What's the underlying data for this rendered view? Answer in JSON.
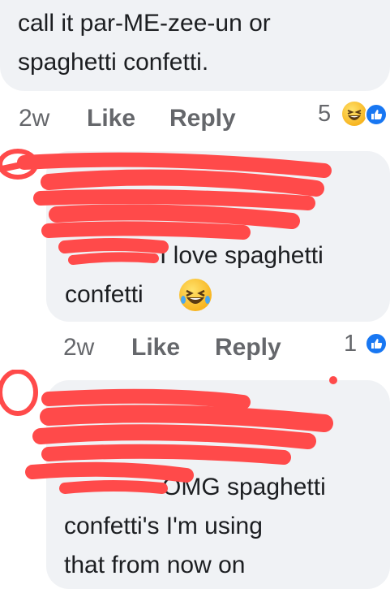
{
  "comments": [
    {
      "text_lines": [
        "call it par-ME-zee-un or",
        "spaghetti confetti."
      ],
      "time": "2w",
      "like_label": "Like",
      "reply_label": "Reply",
      "reaction_count": "5",
      "reactions": [
        "laughing-emoji",
        "like-icon"
      ]
    },
    {
      "text_lines": [
        "I love spaghetti",
        "confetti"
      ],
      "time": "2w",
      "like_label": "Like",
      "reply_label": "Reply",
      "reaction_count": "1",
      "reactions": [
        "like-icon"
      ]
    },
    {
      "text_lines": [
        "OMG spaghetti",
        "confetti's I'm using",
        "that from now on"
      ]
    }
  ],
  "colors": {
    "bubble": "#f0f2f5",
    "meta_text": "#65676b",
    "like_blue": "#1877f2",
    "redaction": "#ff4a4a"
  }
}
